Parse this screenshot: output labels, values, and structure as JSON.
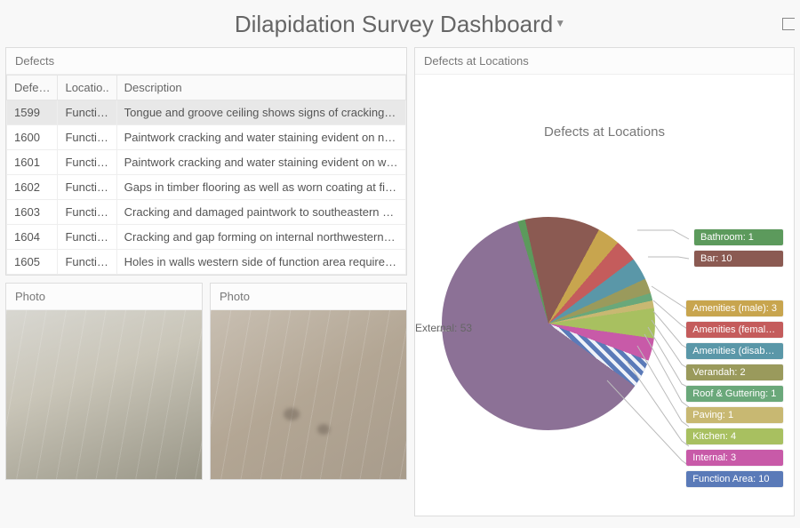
{
  "header": {
    "title": "Dilapidation Survey Dashboard"
  },
  "defects_panel": {
    "title": "Defects",
    "columns": [
      "Defe…",
      "Locatio..",
      "Description"
    ],
    "rows": [
      {
        "id": "1599",
        "loc": "Functio…",
        "desc": "Tongue and groove ceiling shows signs of cracking, water sta…",
        "selected": true
      },
      {
        "id": "1600",
        "loc": "Functio…",
        "desc": "Paintwork cracking and water staining evident on northern w…"
      },
      {
        "id": "1601",
        "loc": "Functio…",
        "desc": "Paintwork cracking and water staining evident on wall adjace…"
      },
      {
        "id": "1602",
        "loc": "Functio…",
        "desc": "Gaps in timber flooring as well as worn coating at filling poin…"
      },
      {
        "id": "1603",
        "loc": "Functio…",
        "desc": "Cracking and damaged paintwork to southeastern corner of …"
      },
      {
        "id": "1604",
        "loc": "Functio…",
        "desc": "Cracking and gap forming on internal northwestern corner o…"
      },
      {
        "id": "1605",
        "loc": "Functio…",
        "desc": "Holes in walls western side of function area require sealing a…"
      }
    ]
  },
  "photos": {
    "title": "Photo"
  },
  "chart_panel": {
    "title": "Defects at Locations",
    "chart_title": "Defects at Locations"
  },
  "chart_data": {
    "type": "pie",
    "title": "Defects at Locations",
    "series": [
      {
        "name": "External",
        "value": 53,
        "color": "#8c7196"
      },
      {
        "name": "Bathroom",
        "value": 1,
        "color": "#5c9a5c"
      },
      {
        "name": "Bar",
        "value": 10,
        "color": "#8b5a52"
      },
      {
        "name": "Amenities (male)",
        "value": 3,
        "color": "#c8a54e"
      },
      {
        "name": "Amenities (femal…",
        "value": 3,
        "color": "#c45c5c"
      },
      {
        "name": "Amenities (disab…",
        "value": 3,
        "color": "#5a97a8"
      },
      {
        "name": "Verandah",
        "value": 2,
        "color": "#9a9a5c"
      },
      {
        "name": "Roof & Guttering",
        "value": 1,
        "color": "#6aa87a"
      },
      {
        "name": "Paving",
        "value": 1,
        "color": "#c8b872"
      },
      {
        "name": "Kitchen",
        "value": 4,
        "color": "#a8c060"
      },
      {
        "name": "Internal",
        "value": 3,
        "color": "#c85aa8"
      },
      {
        "name": "Function Area",
        "value": 10,
        "color": "#5a7ab8"
      }
    ],
    "external_label": "External: 53",
    "legend_group1": [
      {
        "text": "Bathroom: 1",
        "color": "#5c9a5c"
      },
      {
        "text": "Bar: 10",
        "color": "#8b5a52"
      }
    ],
    "legend_group2": [
      {
        "text": "Amenities (male): 3",
        "color": "#c8a54e"
      },
      {
        "text": "Amenities (femal…",
        "color": "#c45c5c"
      },
      {
        "text": "Amenities (disab…",
        "color": "#5a97a8"
      },
      {
        "text": "Verandah: 2",
        "color": "#9a9a5c"
      },
      {
        "text": "Roof & Guttering: 1",
        "color": "#6aa87a"
      },
      {
        "text": "Paving: 1",
        "color": "#c8b872"
      },
      {
        "text": "Kitchen: 4",
        "color": "#a8c060"
      },
      {
        "text": "Internal: 3",
        "color": "#c85aa8"
      },
      {
        "text": "Function Area: 10",
        "color": "#5a7ab8"
      }
    ]
  }
}
